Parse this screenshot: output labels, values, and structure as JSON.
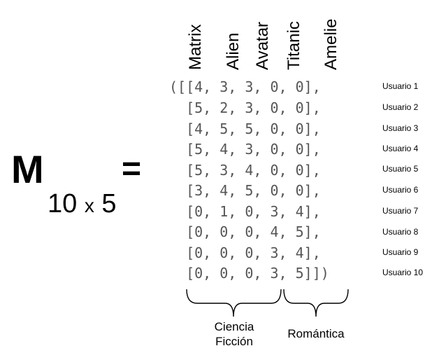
{
  "formula": {
    "letter": "M",
    "subscript_rows": "10",
    "subscript_times": "x",
    "subscript_cols": "5",
    "equals": "="
  },
  "columns": [
    "Matrix",
    "Alien",
    "Avatar",
    "Titanic",
    "Amelie"
  ],
  "matrix_rows": [
    "([[4, 3, 3, 0, 0],",
    "  [5, 2, 3, 0, 0],",
    "  [4, 5, 5, 0, 0],",
    "  [5, 4, 3, 0, 0],",
    "  [5, 3, 4, 0, 0],",
    "  [3, 4, 5, 0, 0],",
    "  [0, 1, 0, 3, 4],",
    "  [0, 0, 0, 4, 5],",
    "  [0, 0, 0, 3, 4],",
    "  [0, 0, 0, 3, 5]])"
  ],
  "row_labels": [
    "Usuario 1",
    "Usuario 2",
    "Usuario 3",
    "Usuario 4",
    "Usuario 5",
    "Usuario 6",
    "Usuario 7",
    "Usuario 8",
    "Usuario 9",
    "Usuario 10"
  ],
  "groups": {
    "scifi_line1": "Ciencia",
    "scifi_line2": "Ficción",
    "romance": "Romántica"
  },
  "colors": {
    "matrix_text": "#555555",
    "label_text": "#000000",
    "brace": "#000000"
  }
}
